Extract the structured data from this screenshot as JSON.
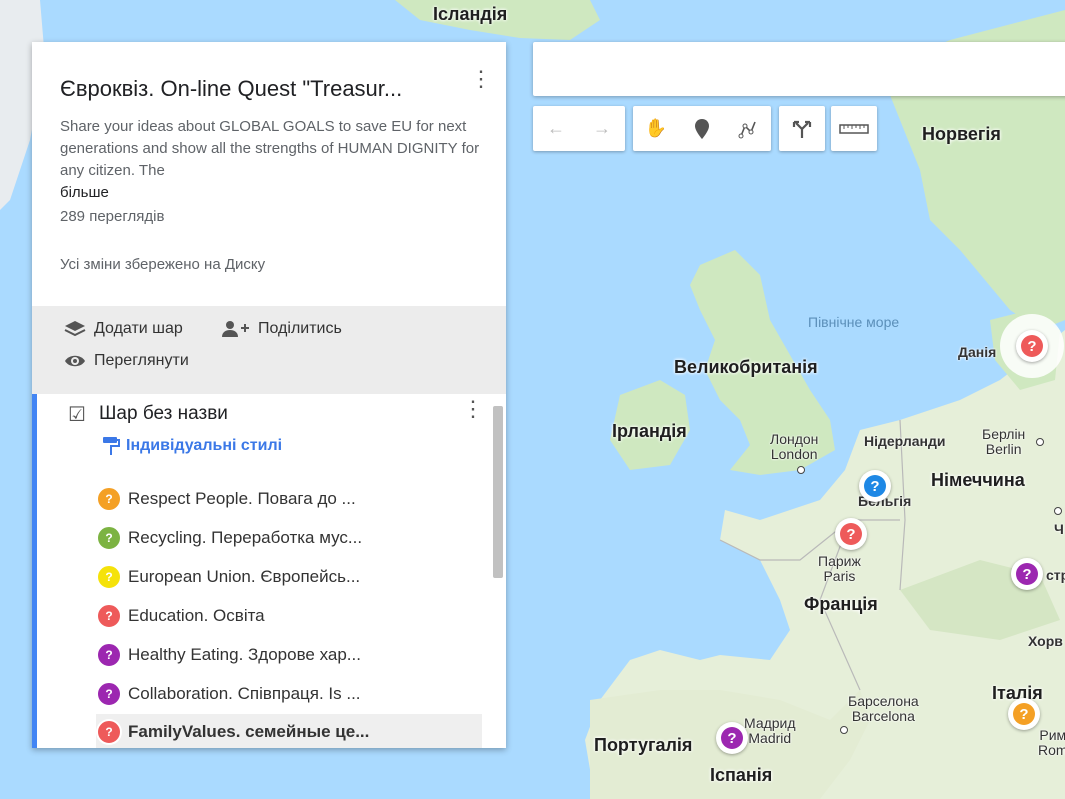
{
  "map": {
    "labels": {
      "iceland": "Ісландія",
      "norway": "Норвегія",
      "north_sea": "Північне море",
      "denmark": "Данія",
      "great_britain": "Великобританія",
      "ireland": "Ірландія",
      "london_uk": "Лондон",
      "london_en": "London",
      "netherlands": "Нідерланди",
      "berlin_uk": "Берлін",
      "berlin_en": "Berlin",
      "germany": "Німеччина",
      "belgium": "Бельгія",
      "paris_uk": "Париж",
      "paris_en": "Paris",
      "france": "Франція",
      "croatia_partial": "Хорв",
      "barcelona_uk": "Барселона",
      "barcelona_en": "Barcelona",
      "italy": "Італія",
      "madrid_uk": "Мадрид",
      "madrid_en": "Madrid",
      "portugal": "Португалія",
      "spain": "Іспанія",
      "rome_uk": "Рим",
      "rome_en": "Rom",
      "austria_partial": "стр",
      "czech_partial": "Ч"
    },
    "marker_glyph": "?"
  },
  "colors": {
    "orange": "#f4a025",
    "green": "#7cb342",
    "yellow": "#f5e20a",
    "red": "#ee5a5a",
    "purple": "#9c27b0",
    "blue": "#1e88e5",
    "accent": "#4285f4"
  },
  "toolbar": {
    "undo_icon": "undo-icon",
    "redo_icon": "redo-icon",
    "hand_icon": "hand-icon",
    "marker_icon": "marker-icon",
    "line_icon": "draw-line-icon",
    "directions_icon": "directions-icon",
    "ruler_icon": "ruler-icon"
  },
  "panel": {
    "title": "Євроквіз. On-line Quest \"Treasur...",
    "description": "Share your ideas about GLOBAL GOALS to save EU for next generations and show all the strengths of HUMAN DIGNITY for any citizen. The",
    "more": "більше",
    "views": "289 переглядів",
    "saved": "Усі зміни збережено на Диску",
    "actions": {
      "add_layer": "Додати шар",
      "share": "Поділитись",
      "preview": "Переглянути"
    },
    "layer": {
      "name": "Шар без назви",
      "styles": "Індивідуальні стилі",
      "items": [
        {
          "label": "Respect People. Повага до ...",
          "color": "orange"
        },
        {
          "label": "Recycling. Переработка мус...",
          "color": "green"
        },
        {
          "label": "European Union. Європейсь...",
          "color": "yellow"
        },
        {
          "label": "Education. Освіта",
          "color": "red"
        },
        {
          "label": "Healthy Eating. Здорове хар...",
          "color": "purple"
        },
        {
          "label": "Collaboration. Співпраця. Is ...",
          "color": "purple"
        },
        {
          "label": "FamilyValues. семейные це...",
          "color": "red"
        }
      ]
    }
  }
}
